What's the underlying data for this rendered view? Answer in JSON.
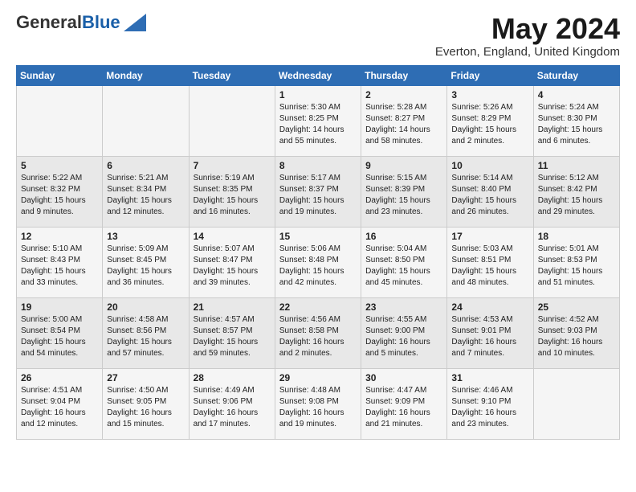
{
  "logo": {
    "general": "General",
    "blue": "Blue"
  },
  "title": "May 2024",
  "location": "Everton, England, United Kingdom",
  "headers": [
    "Sunday",
    "Monday",
    "Tuesday",
    "Wednesday",
    "Thursday",
    "Friday",
    "Saturday"
  ],
  "weeks": [
    [
      {
        "day": "",
        "content": ""
      },
      {
        "day": "",
        "content": ""
      },
      {
        "day": "",
        "content": ""
      },
      {
        "day": "1",
        "content": "Sunrise: 5:30 AM\nSunset: 8:25 PM\nDaylight: 14 hours\nand 55 minutes."
      },
      {
        "day": "2",
        "content": "Sunrise: 5:28 AM\nSunset: 8:27 PM\nDaylight: 14 hours\nand 58 minutes."
      },
      {
        "day": "3",
        "content": "Sunrise: 5:26 AM\nSunset: 8:29 PM\nDaylight: 15 hours\nand 2 minutes."
      },
      {
        "day": "4",
        "content": "Sunrise: 5:24 AM\nSunset: 8:30 PM\nDaylight: 15 hours\nand 6 minutes."
      }
    ],
    [
      {
        "day": "5",
        "content": "Sunrise: 5:22 AM\nSunset: 8:32 PM\nDaylight: 15 hours\nand 9 minutes."
      },
      {
        "day": "6",
        "content": "Sunrise: 5:21 AM\nSunset: 8:34 PM\nDaylight: 15 hours\nand 12 minutes."
      },
      {
        "day": "7",
        "content": "Sunrise: 5:19 AM\nSunset: 8:35 PM\nDaylight: 15 hours\nand 16 minutes."
      },
      {
        "day": "8",
        "content": "Sunrise: 5:17 AM\nSunset: 8:37 PM\nDaylight: 15 hours\nand 19 minutes."
      },
      {
        "day": "9",
        "content": "Sunrise: 5:15 AM\nSunset: 8:39 PM\nDaylight: 15 hours\nand 23 minutes."
      },
      {
        "day": "10",
        "content": "Sunrise: 5:14 AM\nSunset: 8:40 PM\nDaylight: 15 hours\nand 26 minutes."
      },
      {
        "day": "11",
        "content": "Sunrise: 5:12 AM\nSunset: 8:42 PM\nDaylight: 15 hours\nand 29 minutes."
      }
    ],
    [
      {
        "day": "12",
        "content": "Sunrise: 5:10 AM\nSunset: 8:43 PM\nDaylight: 15 hours\nand 33 minutes."
      },
      {
        "day": "13",
        "content": "Sunrise: 5:09 AM\nSunset: 8:45 PM\nDaylight: 15 hours\nand 36 minutes."
      },
      {
        "day": "14",
        "content": "Sunrise: 5:07 AM\nSunset: 8:47 PM\nDaylight: 15 hours\nand 39 minutes."
      },
      {
        "day": "15",
        "content": "Sunrise: 5:06 AM\nSunset: 8:48 PM\nDaylight: 15 hours\nand 42 minutes."
      },
      {
        "day": "16",
        "content": "Sunrise: 5:04 AM\nSunset: 8:50 PM\nDaylight: 15 hours\nand 45 minutes."
      },
      {
        "day": "17",
        "content": "Sunrise: 5:03 AM\nSunset: 8:51 PM\nDaylight: 15 hours\nand 48 minutes."
      },
      {
        "day": "18",
        "content": "Sunrise: 5:01 AM\nSunset: 8:53 PM\nDaylight: 15 hours\nand 51 minutes."
      }
    ],
    [
      {
        "day": "19",
        "content": "Sunrise: 5:00 AM\nSunset: 8:54 PM\nDaylight: 15 hours\nand 54 minutes."
      },
      {
        "day": "20",
        "content": "Sunrise: 4:58 AM\nSunset: 8:56 PM\nDaylight: 15 hours\nand 57 minutes."
      },
      {
        "day": "21",
        "content": "Sunrise: 4:57 AM\nSunset: 8:57 PM\nDaylight: 15 hours\nand 59 minutes."
      },
      {
        "day": "22",
        "content": "Sunrise: 4:56 AM\nSunset: 8:58 PM\nDaylight: 16 hours\nand 2 minutes."
      },
      {
        "day": "23",
        "content": "Sunrise: 4:55 AM\nSunset: 9:00 PM\nDaylight: 16 hours\nand 5 minutes."
      },
      {
        "day": "24",
        "content": "Sunrise: 4:53 AM\nSunset: 9:01 PM\nDaylight: 16 hours\nand 7 minutes."
      },
      {
        "day": "25",
        "content": "Sunrise: 4:52 AM\nSunset: 9:03 PM\nDaylight: 16 hours\nand 10 minutes."
      }
    ],
    [
      {
        "day": "26",
        "content": "Sunrise: 4:51 AM\nSunset: 9:04 PM\nDaylight: 16 hours\nand 12 minutes."
      },
      {
        "day": "27",
        "content": "Sunrise: 4:50 AM\nSunset: 9:05 PM\nDaylight: 16 hours\nand 15 minutes."
      },
      {
        "day": "28",
        "content": "Sunrise: 4:49 AM\nSunset: 9:06 PM\nDaylight: 16 hours\nand 17 minutes."
      },
      {
        "day": "29",
        "content": "Sunrise: 4:48 AM\nSunset: 9:08 PM\nDaylight: 16 hours\nand 19 minutes."
      },
      {
        "day": "30",
        "content": "Sunrise: 4:47 AM\nSunset: 9:09 PM\nDaylight: 16 hours\nand 21 minutes."
      },
      {
        "day": "31",
        "content": "Sunrise: 4:46 AM\nSunset: 9:10 PM\nDaylight: 16 hours\nand 23 minutes."
      },
      {
        "day": "",
        "content": ""
      }
    ]
  ]
}
